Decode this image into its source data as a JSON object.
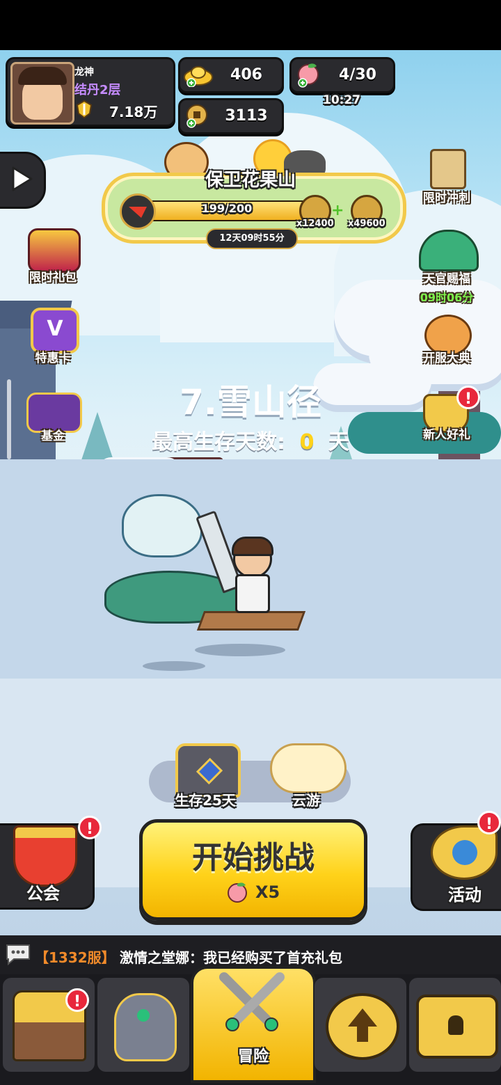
{
  "player": {
    "name": "龙神",
    "realm": "结丹2层",
    "power": "7.18万"
  },
  "resources": {
    "gold": "406",
    "coins": "3113",
    "stamina": "4/30",
    "stamina_timer": "10:27"
  },
  "event": {
    "title": "保卫花果山",
    "progress_text": "199/200",
    "progress": 0.995,
    "reward1": "x12400",
    "reward2": "x49600",
    "countdown": "12天09时55分"
  },
  "side_left": [
    "限时礼包",
    "特惠卡",
    "基金"
  ],
  "side_right": {
    "sprint": "限时冲刺",
    "blessing": "天官赐福",
    "blessing_timer": "09时06分",
    "opening": "开服大典",
    "newbie": "新人好礼"
  },
  "stage": {
    "name": "7.雪山径",
    "best_label": "最高生存天数:",
    "best_value": "0",
    "best_unit": "天"
  },
  "rewards": {
    "chest_label": "生存25天",
    "cloud_label": "云游"
  },
  "actions": {
    "guild": "公会",
    "start": "开始挑战",
    "start_cost": "X5",
    "activity": "活动",
    "badge": "!"
  },
  "chat": {
    "server": "【1332服】",
    "message": "激情之堂娜：我已经购买了首充礼包"
  },
  "nav": {
    "adventure": "冒险"
  },
  "colors": {
    "accent_yellow": "#ffd21a",
    "timer_green": "#7cf04a",
    "badge_red": "#e8283c",
    "realm_purple": "#c68cff"
  }
}
